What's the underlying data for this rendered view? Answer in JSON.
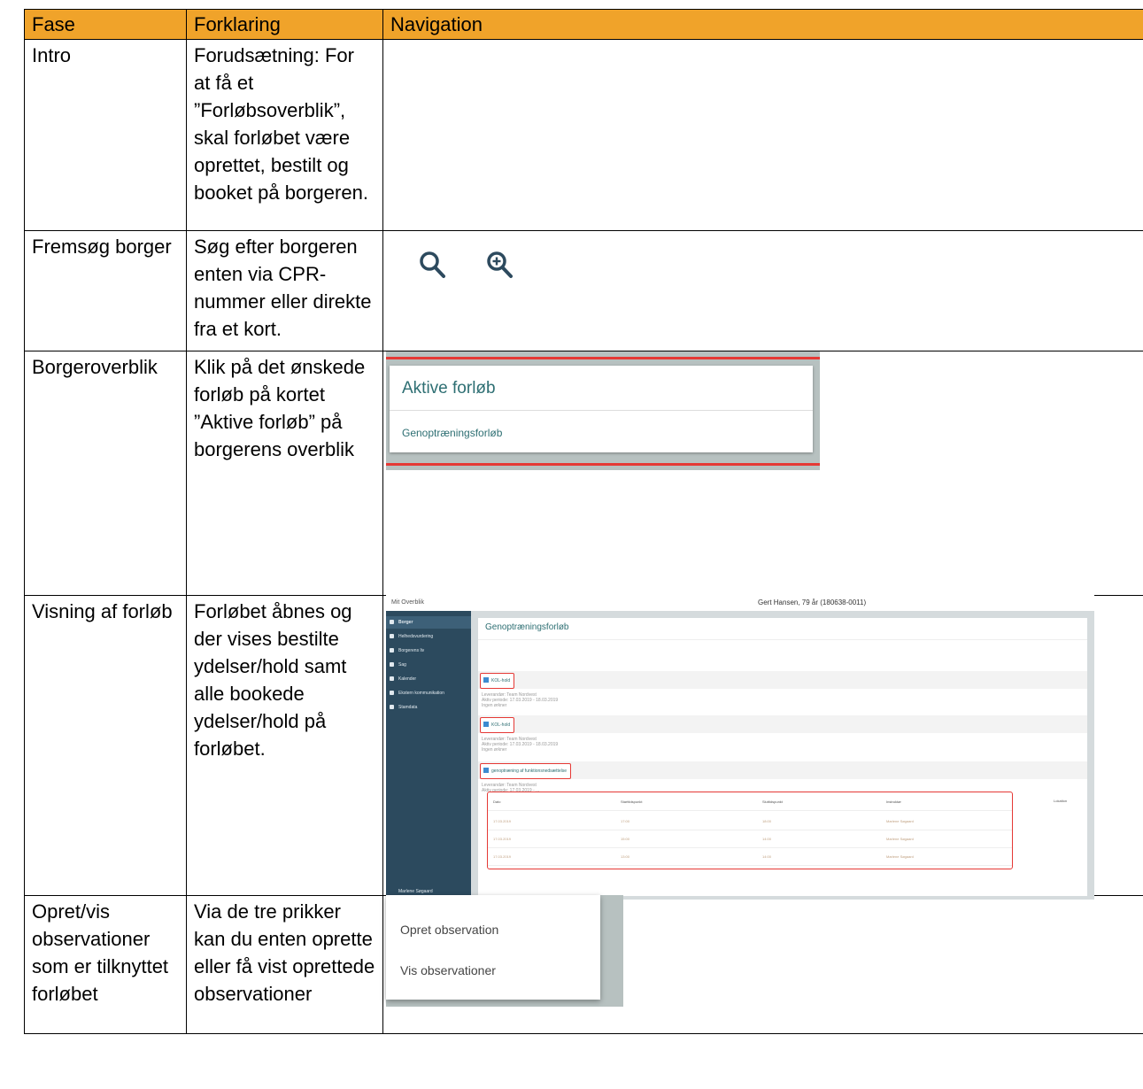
{
  "table": {
    "headers": [
      "Fase",
      "Forklaring",
      "Navigation"
    ],
    "rows": [
      {
        "fase": "Intro",
        "forklaring": "Forudsætning: For at få et ”Forløbsoverblik”, skal forløbet være oprettet, bestilt og booket på borgeren."
      },
      {
        "fase": "Fremsøg borger",
        "forklaring": "Søg efter borgeren enten via CPR-nummer eller direkte fra et kort."
      },
      {
        "fase": "Borgeroverblik",
        "forklaring": "Klik på det ønskede forløb på kortet ”Aktive forløb” på borgerens overblik"
      },
      {
        "fase": "Visning af forløb",
        "forklaring": "Forløbet åbnes og der vises bestilte ydelser/hold samt alle bookede ydelser/hold på forløbet."
      },
      {
        "fase": "Opret/vis observationer som er tilknyttet forløbet",
        "forklaring": "Via de tre prikker kan du enten oprette eller få vist oprettede observationer"
      }
    ]
  },
  "icons": {
    "search": "search-icon",
    "zoom_in": "zoom-in-icon"
  },
  "aktive_card": {
    "title": "Aktive forløb",
    "item": "Genoptræningsforløb"
  },
  "app": {
    "brand": "Mit Overblik",
    "patient": "Gert Hansen, 79 år (180638-0011)",
    "sidebar": [
      "Borger",
      "Helhedsvurdering",
      "Borgerens liv",
      "Sag",
      "Kalender",
      "Ekstern kommunikation",
      "Stamdata"
    ],
    "user": "Marlene Søgaard",
    "panel_title": "Genoptræningsforløb",
    "groups": [
      "KOL-hold",
      "KOL-hold",
      "genoptræning af funktionsnedsættelse"
    ],
    "meta_lines": [
      [
        "Leverandør: Team Nordvest",
        "Aktiv periode: 17.03.2019 - 18.03.2019",
        "Ingen ørkner"
      ],
      [
        "Leverandør: Team Nordvest",
        "Aktiv periode: 17.03.2019 - 18.03.2019",
        "Ingen ørkner"
      ],
      [
        "Leverandør: Team Nordvest",
        "Aktiv periode: 17.03.2019 - ..."
      ]
    ],
    "schedule_headers": [
      "Dato",
      "Starttidspunkt",
      "Sluttidspunkt",
      "Instruktør"
    ],
    "location_header": "Lokation",
    "schedule_rows": [
      [
        "17.03.2019",
        "17:00",
        "18:00",
        "Marlene Søgaard"
      ],
      [
        "17.03.2019",
        "15:00",
        "14:00",
        "Marlene Søgaard"
      ],
      [
        "17.03.2019",
        "13:00",
        "14:00",
        "Marlene Søgaard"
      ]
    ]
  },
  "menu": {
    "items": [
      "Opret observation",
      "Vis observationer"
    ]
  }
}
